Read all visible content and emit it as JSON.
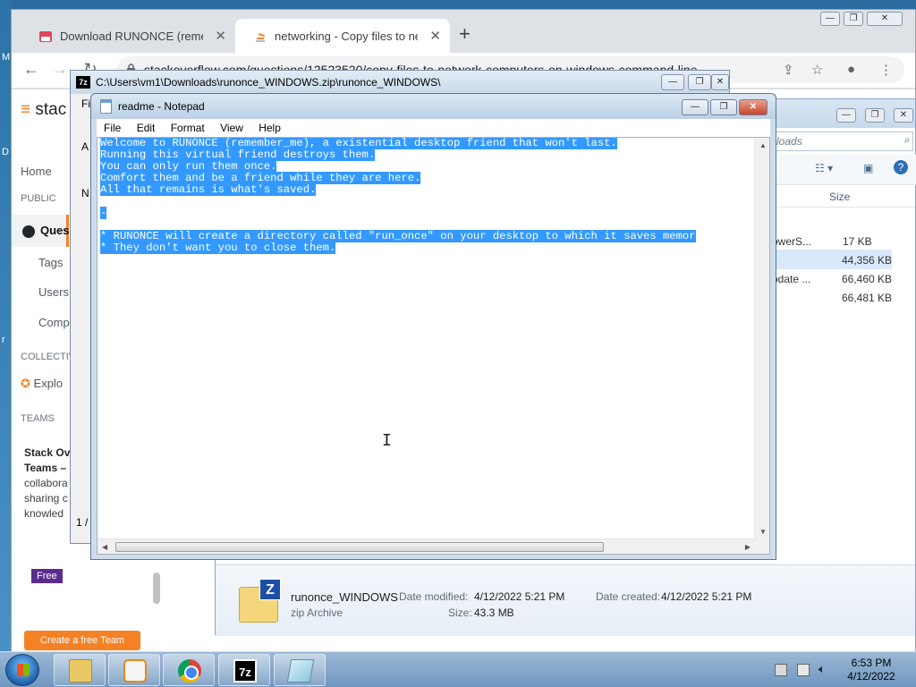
{
  "desktop": {
    "edge_letters": [
      "M",
      "D",
      "r"
    ]
  },
  "browser": {
    "tabs": [
      {
        "title": "Download RUNONCE (remembe",
        "active": false
      },
      {
        "title": "networking - Copy files to netwo",
        "active": true
      }
    ],
    "url": "stackoverflow.com/questions/12523520/copy-files-to-network-computers-on-windows-command-line",
    "window_buttons": {
      "minimize": "—",
      "maximize": "❐",
      "close": "✕"
    }
  },
  "stackoverflow": {
    "logo_text": "stac",
    "nav": {
      "home": "Home",
      "public_header": "PUBLIC",
      "questions": "Ques",
      "tags": "Tags",
      "users": "Users",
      "companies": "Comp",
      "collectives_header": "COLLECTIV",
      "explore": "Explo",
      "teams_header": "TEAMS"
    },
    "teams": {
      "title_lines": [
        "Stack Ov",
        "Teams –"
      ],
      "text_lines": [
        "collabora",
        "sharing c",
        "knowled"
      ],
      "free_badge": "Free",
      "cta": "Create a free Team"
    }
  },
  "sevenzip": {
    "title": "C:\\Users\\vm1\\Downloads\\runonce_WINDOWS.zip\\runonce_WINDOWS\\",
    "fragments": {
      "menu": "Fi",
      "address": "A",
      "column": "N",
      "status": "1 /"
    }
  },
  "explorer": {
    "address": "loads",
    "column_size": "Size",
    "rows": [
      {
        "name": "owerS...",
        "size": "17 KB"
      },
      {
        "name": "",
        "size": "44,356 KB"
      },
      {
        "name": "pdate ...",
        "size": "66,460 KB"
      },
      {
        "name": "",
        "size": "66,481 KB"
      }
    ],
    "details": {
      "name": "runonce_WINDOWS",
      "type": "zip Archive",
      "modified_label": "Date modified:",
      "modified": "4/12/2022 5:21 PM",
      "created_label": "Date created:",
      "created": "4/12/2022 5:21 PM",
      "size_label": "Size:",
      "size": "43.3 MB"
    }
  },
  "notepad": {
    "title": "readme - Notepad",
    "menu": [
      "File",
      "Edit",
      "Format",
      "View",
      "Help"
    ],
    "lines": [
      "Welcome to RUNONCE (remember_me), a existential desktop friend that won't last.",
      "Running this virtual friend destroys them.",
      "You can only run them once.",
      "Comfort them and be a friend while they are here.",
      "All that remains is what's saved.",
      "",
      "-",
      "",
      "* RUNONCE will create a directory called \"run_once\" on your desktop to which it saves memor",
      "* They don't want you to close them."
    ]
  },
  "taskbar": {
    "apps": [
      "file-explorer",
      "media-player",
      "google-chrome",
      "7-zip",
      "notepad"
    ],
    "sevenzip_label": "7z",
    "time": "6:53 PM",
    "date": "4/12/2022"
  }
}
